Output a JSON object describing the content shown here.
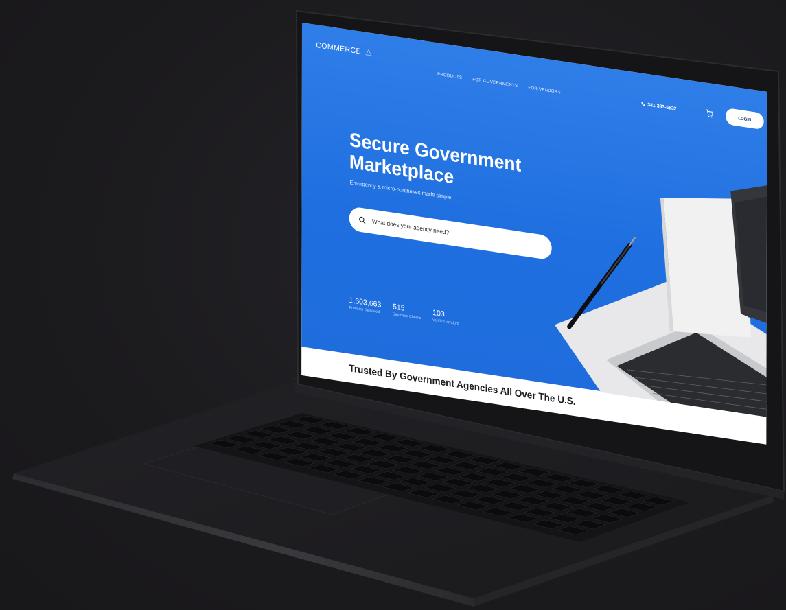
{
  "site": {
    "logo": "COMMERCE",
    "nav": [
      "PRODUCTS",
      "FOR GOVERNMENTS",
      "FOR VENDORS"
    ],
    "phone": "341-333-6532",
    "login": "LOGIN",
    "hero_title": "Secure Government\nMarketplace",
    "hero_subtitle": "Emergency & micro-purchases made simple.",
    "search_placeholder": "What does your agency need?",
    "stats": [
      {
        "value": "1,603,663",
        "label": "Products Delivered"
      },
      {
        "value": "515",
        "label": "Database Checks"
      },
      {
        "value": "103",
        "label": "Verified Vendors"
      }
    ],
    "trusted": "Trusted By Government Agencies All Over The U.S."
  },
  "colors": {
    "hero_blue": "#2474e4",
    "background": "#1b1a1d",
    "laptop_body": "#1e1e21"
  },
  "icons": [
    "logo-triangle-icon",
    "phone-icon",
    "cart-icon",
    "search-icon"
  ]
}
